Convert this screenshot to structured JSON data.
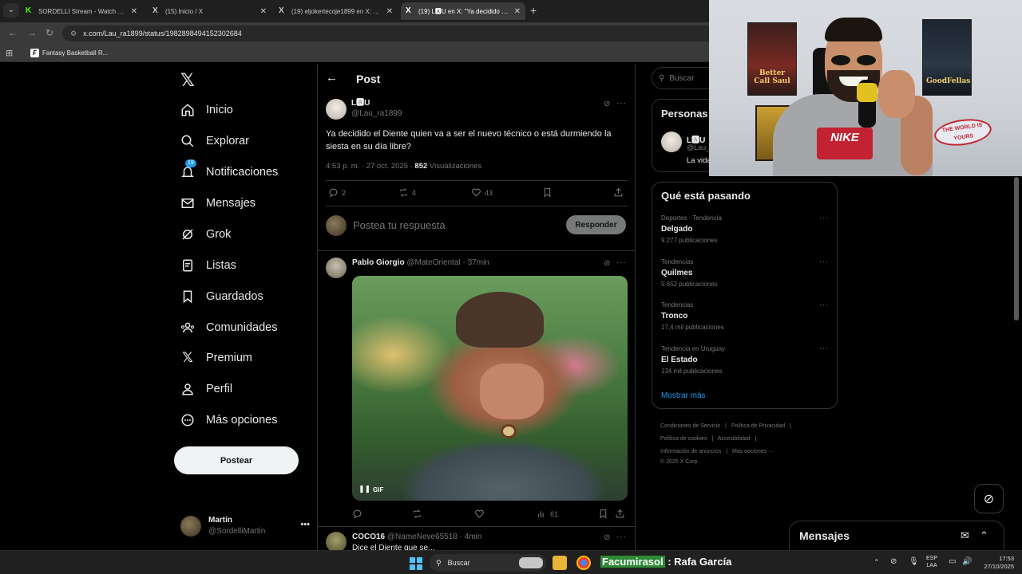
{
  "browser": {
    "tabs": [
      {
        "title": "SORDELLI Stream - Watch Live o",
        "favicon": "K",
        "favicon_color": "#53fc18"
      },
      {
        "title": "(15) Inicio / X",
        "favicon": "X",
        "favicon_color": "#ffffff"
      },
      {
        "title": "(19) eljokertecoje1899 en X: \"@",
        "favicon": "X",
        "favicon_color": "#ffffff"
      },
      {
        "title": "(19) L🅰U en X: \"Ya decidido el D",
        "favicon": "X",
        "favicon_color": "#ffffff",
        "active": true
      }
    ],
    "url": "x.com/Lau_ra1899/status/1982898494152302684",
    "bookmark": "Fantasy Basketball R..."
  },
  "nav": {
    "items": [
      {
        "label": "Inicio",
        "icon": "home-icon"
      },
      {
        "label": "Explorar",
        "icon": "search-icon"
      },
      {
        "label": "Notificaciones",
        "icon": "bell-icon",
        "badge": "19"
      },
      {
        "label": "Mensajes",
        "icon": "mail-icon"
      },
      {
        "label": "Grok",
        "icon": "grok-icon"
      },
      {
        "label": "Listas",
        "icon": "list-icon"
      },
      {
        "label": "Guardados",
        "icon": "bookmark-icon"
      },
      {
        "label": "Comunidades",
        "icon": "people-icon"
      },
      {
        "label": "Premium",
        "icon": "x-icon"
      },
      {
        "label": "Perfil",
        "icon": "person-icon"
      },
      {
        "label": "Más opciones",
        "icon": "more-circle-icon"
      }
    ],
    "post_button": "Postear",
    "account": {
      "name": "Martín",
      "handle": "@SordelliMartin"
    }
  },
  "main": {
    "header": "Post",
    "post": {
      "author_name": "L🅰U",
      "author_handle": "@Lau_ra1899",
      "text": "Ya decidido el Diente quien va a ser el nuevo técnico o está durmiendo la siesta en su día libre?",
      "time": "4:53 p. m. · 27 oct. 2025 · ",
      "views_count": "852",
      "views_label": " Visualizaciones",
      "replies": "2",
      "reposts": "4",
      "likes": "43"
    },
    "reply_placeholder": "Postea tu respuesta",
    "reply_button": "Responder",
    "replies": [
      {
        "name": "Pablo Giorgio",
        "handle": "@MateOriental · 37min",
        "gif_label": "GIF",
        "views": "61"
      },
      {
        "name": "COCO16",
        "handle": "@NameNeve65518 · 4min",
        "text": "Dice el Diente que se..."
      }
    ]
  },
  "right": {
    "search_placeholder": "Buscar",
    "relevant_title": "Personas",
    "relevant": {
      "name": "L🅰U",
      "handle": "@Lau_",
      "bio": "La vida"
    },
    "trends_title": "Qué está pasando",
    "trends": [
      {
        "context": "Deportes · Tendencia",
        "name": "Delgado",
        "count": "9.277 publicaciones"
      },
      {
        "context": "Tendencias",
        "name": "Quilmes",
        "count": "5.652 publicaciones"
      },
      {
        "context": "Tendencias",
        "name": "Tronco",
        "count": "17,4 mil publicaciones"
      },
      {
        "context": "Tendencia en Uruguay",
        "name": "El Estado",
        "count": "134 mil publicaciones"
      }
    ],
    "show_more": "Mostrar más",
    "footer": {
      "line1": [
        "Condiciones de Servicio",
        "|",
        "Política de Privacidad",
        "|"
      ],
      "line2": [
        "Política de cookies",
        "|",
        "Accesibilidad",
        "|"
      ],
      "line3": [
        "Información de anuncios",
        "|",
        "Más opciones ···"
      ],
      "line4": [
        "© 2025 X Corp."
      ]
    },
    "messages_drawer": "Mensajes"
  },
  "webcam": {
    "poster_left": "Better Call Saul",
    "poster_right": "GoodFellas",
    "sticker": "THE WORLD IS YOURS",
    "shirt": "NIKE"
  },
  "taskbar": {
    "search": "Buscar",
    "overlay_user": "Facumirasol",
    "overlay_rest": " : Rafa García",
    "lang_top": "ESP",
    "lang_bottom": "LAA",
    "time": "17:53",
    "date": "27/10/2025"
  },
  "colors": {
    "accent": "#1d9bf0",
    "background": "#000000",
    "text": "#e7e9ea",
    "muted": "#71767b",
    "border": "#2f3336"
  }
}
